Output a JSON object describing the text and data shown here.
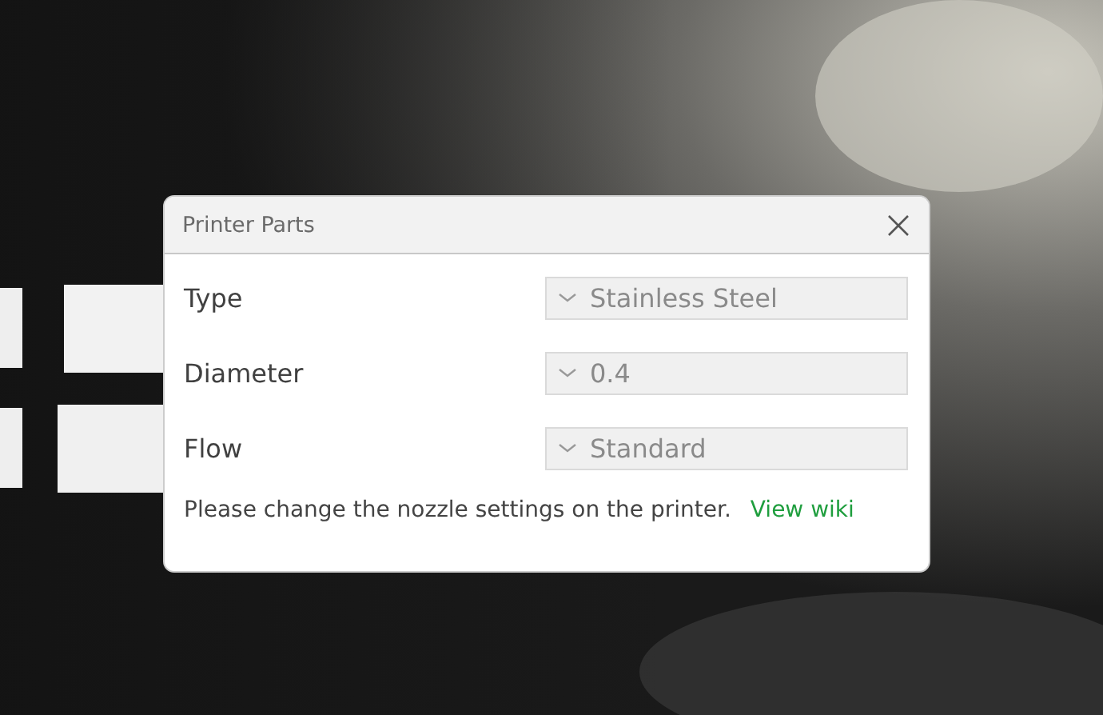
{
  "dialog": {
    "title": "Printer Parts",
    "fields": [
      {
        "label": "Type",
        "value": "Stainless Steel",
        "disabled": true
      },
      {
        "label": "Diameter",
        "value": "0.4",
        "disabled": true
      },
      {
        "label": "Flow",
        "value": "Standard",
        "disabled": true
      }
    ],
    "note": "Please change the nozzle settings on the printer.",
    "link": "View wiki"
  }
}
